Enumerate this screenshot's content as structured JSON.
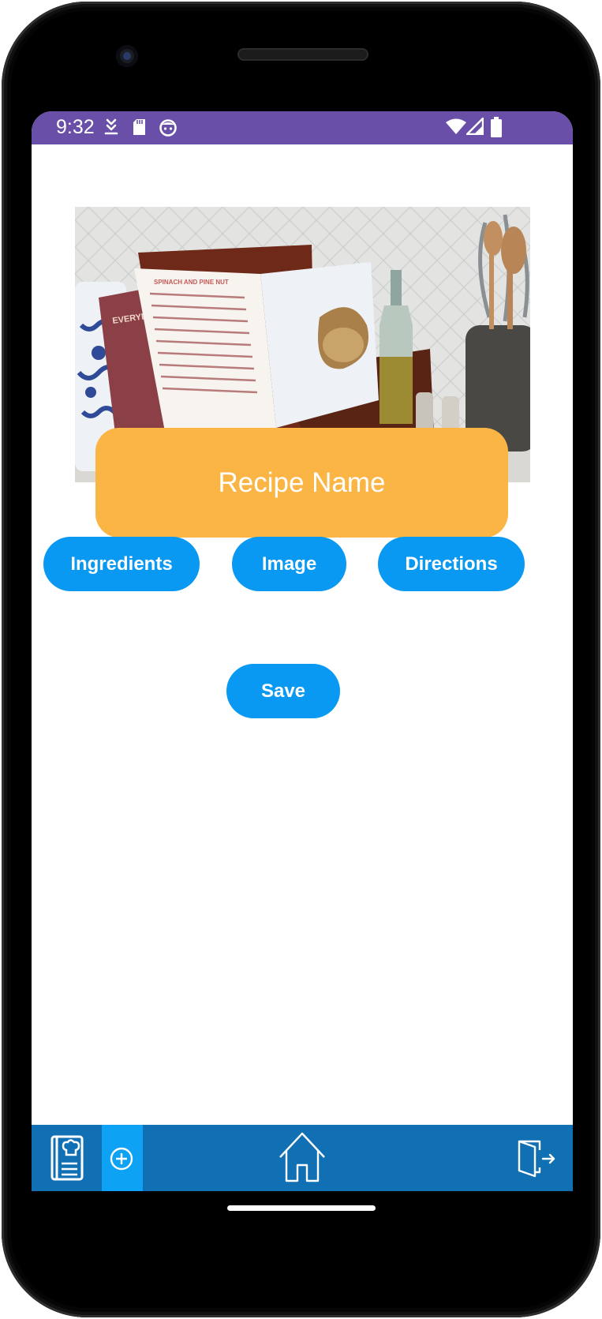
{
  "status_bar": {
    "time": "9:32",
    "icons": [
      "download-icon",
      "sd-card-icon",
      "face-icon",
      "wifi-icon",
      "signal-icon",
      "battery-icon"
    ]
  },
  "hero_image": {
    "description": "open recipe book on wooden stand in kitchen"
  },
  "recipe_name": {
    "placeholder": "Recipe Name"
  },
  "buttons": {
    "ingredients": "Ingredients",
    "image": "Image",
    "directions": "Directions",
    "save": "Save"
  },
  "bottom_nav": {
    "items": [
      {
        "icon": "recipe-book-icon"
      },
      {
        "icon": "add-circle-icon"
      },
      {
        "icon": "home-icon"
      },
      {
        "icon": "logout-icon"
      }
    ]
  },
  "colors": {
    "status_bar": "#6a4fa8",
    "name_field": "#fbb544",
    "button": "#0a99f2",
    "nav_bar": "#1170b4",
    "nav_active": "#0ea2f5"
  }
}
